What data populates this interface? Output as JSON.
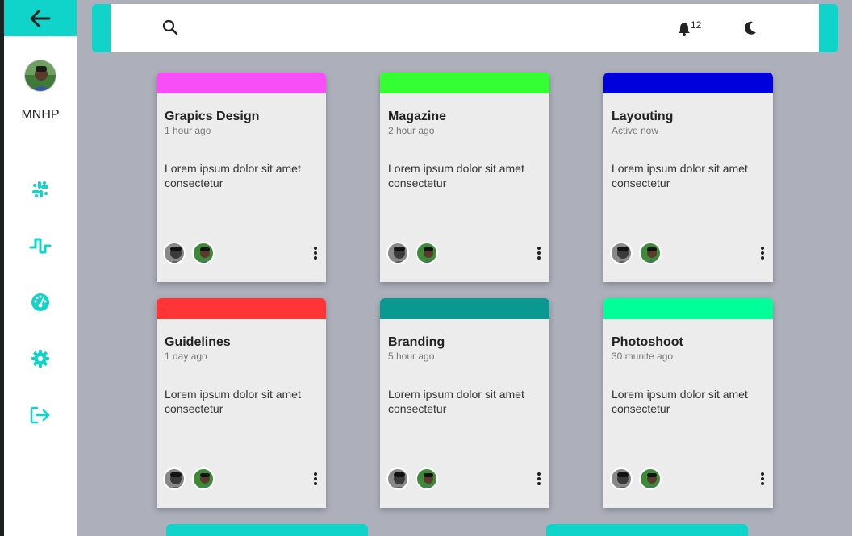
{
  "colors": {
    "accent": "#10d3c9",
    "sidebar_bg": "#ffffff",
    "page_bg": "#adb0bb"
  },
  "sidebar": {
    "back_icon": "arrow-left-icon",
    "username": "MNHP",
    "nav": [
      {
        "icon": "slack-icon"
      },
      {
        "icon": "pulse-wave-icon"
      },
      {
        "icon": "gauge-icon"
      },
      {
        "icon": "gear-icon"
      },
      {
        "icon": "logout-icon"
      }
    ]
  },
  "topbar": {
    "search_icon": "search-icon",
    "notification_count": "12",
    "theme_icon": "moon-icon"
  },
  "cards": [
    {
      "title": "Grapics Design",
      "time": "1 hour ago",
      "desc": "Lorem ipsum dolor sit amet consectetur",
      "color": "#f74ef7"
    },
    {
      "title": "Magazine",
      "time": "2 hour ago",
      "desc": "Lorem ipsum dolor sit amet consectetur",
      "color": "#33ff33"
    },
    {
      "title": "Layouting",
      "time": "Active now",
      "desc": "Lorem ipsum dolor sit amet consectetur",
      "color": "#0000dd"
    },
    {
      "title": "Guidelines",
      "time": "1 day ago",
      "desc": "Lorem ipsum dolor sit amet consectetur",
      "color": "#ff3535"
    },
    {
      "title": "Branding",
      "time": "5 hour ago",
      "desc": "Lorem ipsum dolor sit amet consectetur",
      "color": "#0a9990"
    },
    {
      "title": "Photoshoot",
      "time": "30 munite ago",
      "desc": "Lorem ipsum dolor sit amet consectetur",
      "color": "#00ff99"
    }
  ]
}
